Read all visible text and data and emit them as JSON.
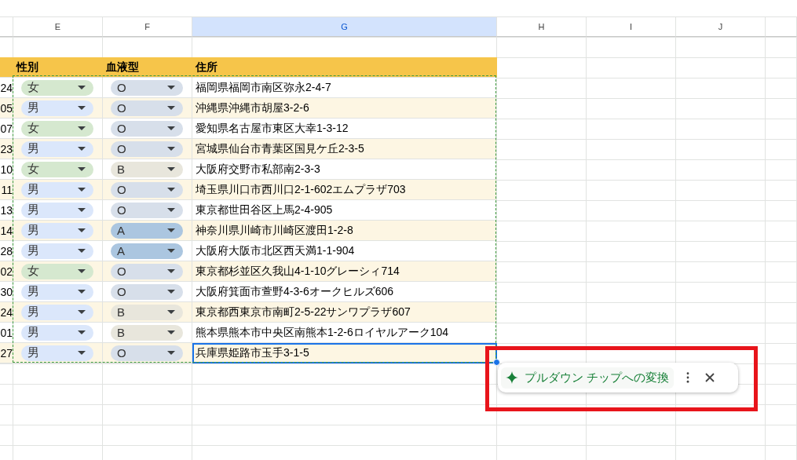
{
  "columns": [
    {
      "letter": "E",
      "selected": false
    },
    {
      "letter": "F",
      "selected": false
    },
    {
      "letter": "G",
      "selected": true
    },
    {
      "letter": "H",
      "selected": false
    },
    {
      "letter": "I",
      "selected": false
    },
    {
      "letter": "J",
      "selected": false
    }
  ],
  "table": {
    "headers": [
      "性別",
      "血液型",
      "住所"
    ],
    "rows": [
      {
        "column_d": "24",
        "gender": {
          "value": "女",
          "color": "#d5e8cf"
        },
        "blood": {
          "value": "O",
          "color": "#d7dfea"
        },
        "address": "福岡県福岡市南区弥永2-4-7",
        "selected": false
      },
      {
        "column_d": "05",
        "gender": {
          "value": "男",
          "color": "#dbe7fb"
        },
        "blood": {
          "value": "O",
          "color": "#d7dfea"
        },
        "address": "沖縄県沖縄市胡屋3-2-6",
        "selected": false
      },
      {
        "column_d": "07",
        "gender": {
          "value": "女",
          "color": "#d5e8cf"
        },
        "blood": {
          "value": "O",
          "color": "#d7dfea"
        },
        "address": "愛知県名古屋市東区大幸1-3-12",
        "selected": false
      },
      {
        "column_d": "23",
        "gender": {
          "value": "男",
          "color": "#dbe7fb"
        },
        "blood": {
          "value": "O",
          "color": "#d7dfea"
        },
        "address": "宮城県仙台市青葉区国見ケ丘2-3-5",
        "selected": false
      },
      {
        "column_d": "10",
        "gender": {
          "value": "女",
          "color": "#d5e8cf"
        },
        "blood": {
          "value": "B",
          "color": "#e8e6dc"
        },
        "address": "大阪府交野市私部南2-3-3",
        "selected": false
      },
      {
        "column_d": "11",
        "gender": {
          "value": "男",
          "color": "#dbe7fb"
        },
        "blood": {
          "value": "O",
          "color": "#d7dfea"
        },
        "address": "埼玉県川口市西川口2-1-602エムプラザ703",
        "selected": false
      },
      {
        "column_d": "13",
        "gender": {
          "value": "男",
          "color": "#dbe7fb"
        },
        "blood": {
          "value": "O",
          "color": "#d7dfea"
        },
        "address": "東京都世田谷区上馬2-4-905",
        "selected": false
      },
      {
        "column_d": "14",
        "gender": {
          "value": "男",
          "color": "#dbe7fb"
        },
        "blood": {
          "value": "A",
          "color": "#abc6e0"
        },
        "address": "神奈川県川崎市川崎区渡田1-2-8",
        "selected": false
      },
      {
        "column_d": "28",
        "gender": {
          "value": "男",
          "color": "#dbe7fb"
        },
        "blood": {
          "value": "A",
          "color": "#abc6e0"
        },
        "address": "大阪府大阪市北区西天満1-1-904",
        "selected": false
      },
      {
        "column_d": "02",
        "gender": {
          "value": "女",
          "color": "#d5e8cf"
        },
        "blood": {
          "value": "O",
          "color": "#d7dfea"
        },
        "address": "東京都杉並区久我山4-1-10グレーシィ714",
        "selected": false
      },
      {
        "column_d": "30",
        "gender": {
          "value": "男",
          "color": "#dbe7fb"
        },
        "blood": {
          "value": "O",
          "color": "#d7dfea"
        },
        "address": "大阪府箕面市萱野4-3-6オークヒルズ606",
        "selected": false
      },
      {
        "column_d": "24",
        "gender": {
          "value": "男",
          "color": "#dbe7fb"
        },
        "blood": {
          "value": "B",
          "color": "#e8e6dc"
        },
        "address": "東京都西東京市南町2-5-22サンワプラザ607",
        "selected": false
      },
      {
        "column_d": "01",
        "gender": {
          "value": "男",
          "color": "#dbe7fb"
        },
        "blood": {
          "value": "B",
          "color": "#e8e6dc"
        },
        "address": "熊本県熊本市中央区南熊本1-2-6ロイヤルアーク104",
        "selected": false
      },
      {
        "column_d": "27",
        "gender": {
          "value": "男",
          "color": "#dbe7fb"
        },
        "blood": {
          "value": "O",
          "color": "#d7dfea"
        },
        "address": "兵庫県姫路市玉手3-1-5",
        "selected": true
      }
    ]
  },
  "suggestion": {
    "label": "プルダウン チップへの変換"
  }
}
